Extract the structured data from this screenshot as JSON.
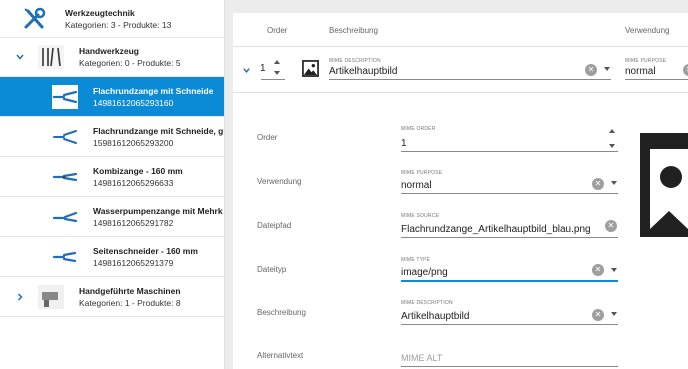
{
  "sidebar": {
    "items": [
      {
        "title": "Werkzeugtechnik",
        "subtitle": "Kategorien: 3 - Produkte: 13"
      },
      {
        "title": "Handwerkzeug",
        "subtitle": "Kategorien: 0 - Produkte: 5"
      },
      {
        "title": "Flachrundzange mit Schneide",
        "subtitle": "14981612065293160"
      },
      {
        "title": "Flachrundzange mit Schneide, ge",
        "subtitle": "15981612065293200"
      },
      {
        "title": "Kombizange - 160 mm",
        "subtitle": "14981612065296633"
      },
      {
        "title": "Wasserpumpenzange mit Mehrko",
        "subtitle": "14981612065291782"
      },
      {
        "title": "Seitenschneider - 160 mm",
        "subtitle": "14981612065291379"
      },
      {
        "title": "Handgeführte Maschinen",
        "subtitle": "Kategorien: 1 - Produkte: 8"
      }
    ]
  },
  "table": {
    "headers": {
      "order": "Order",
      "description": "Beschreibung",
      "usage": "Verwendung"
    },
    "row": {
      "order": "1",
      "description_label": "MIME DESCRIPTION",
      "description": "Artikelhauptbild",
      "purpose_label": "MIME PURPOSE",
      "purpose": "normal"
    }
  },
  "detail": {
    "order": {
      "label": "Order",
      "small": "MIME ORDER",
      "value": "1"
    },
    "usage": {
      "label": "Verwendung",
      "small": "MIME PURPOSE",
      "value": "normal"
    },
    "path": {
      "label": "Dateipfad",
      "small": "MIME SOURCE",
      "value": "Flachrundzange_Artikelhauptbild_blau.png"
    },
    "type": {
      "label": "Dateityp",
      "small": "MIME TYPE",
      "value": "image/png"
    },
    "description": {
      "label": "Beschreibung",
      "small": "MIME DESCRIPTION",
      "value": "Artikelhauptbild"
    },
    "alt": {
      "label": "Alternativtext",
      "placeholder": "MIME ALT"
    }
  },
  "colors": {
    "accent": "#0b8ad6",
    "icon_dark": "#212121"
  }
}
